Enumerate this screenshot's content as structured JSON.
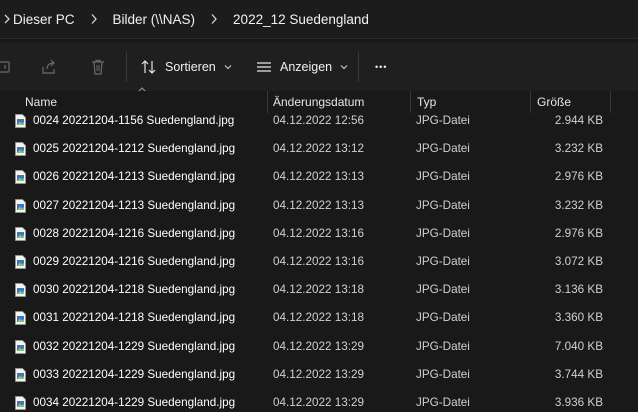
{
  "breadcrumb": {
    "items": [
      "Dieser PC",
      "Bilder (\\\\NAS)",
      "2022_12 Suedengland"
    ]
  },
  "toolbar": {
    "sort_label": "Sortieren",
    "view_label": "Anzeigen",
    "more_label": "•••"
  },
  "columns": {
    "name": "Name",
    "date": "Änderungsdatum",
    "type": "Typ",
    "size": "Größe"
  },
  "files": [
    {
      "name": "0024 20221204-1156 Suedengland.jpg",
      "date": "04.12.2022 12:56",
      "type": "JPG-Datei",
      "size": "2.944 KB"
    },
    {
      "name": "0025 20221204-1212 Suedengland.jpg",
      "date": "04.12.2022 13:12",
      "type": "JPG-Datei",
      "size": "3.232 KB"
    },
    {
      "name": "0026 20221204-1213 Suedengland.jpg",
      "date": "04.12.2022 13:13",
      "type": "JPG-Datei",
      "size": "2.976 KB"
    },
    {
      "name": "0027 20221204-1213 Suedengland.jpg",
      "date": "04.12.2022 13:13",
      "type": "JPG-Datei",
      "size": "3.232 KB"
    },
    {
      "name": "0028 20221204-1216 Suedengland.jpg",
      "date": "04.12.2022 13:16",
      "type": "JPG-Datei",
      "size": "2.976 KB"
    },
    {
      "name": "0029 20221204-1216 Suedengland.jpg",
      "date": "04.12.2022 13:16",
      "type": "JPG-Datei",
      "size": "3.072 KB"
    },
    {
      "name": "0030 20221204-1218 Suedengland.jpg",
      "date": "04.12.2022 13:18",
      "type": "JPG-Datei",
      "size": "3.136 KB"
    },
    {
      "name": "0031 20221204-1218 Suedengland.jpg",
      "date": "04.12.2022 13:18",
      "type": "JPG-Datei",
      "size": "3.360 KB"
    },
    {
      "name": "0032 20221204-1229 Suedengland.jpg",
      "date": "04.12.2022 13:29",
      "type": "JPG-Datei",
      "size": "7.040 KB"
    },
    {
      "name": "0033 20221204-1229 Suedengland.jpg",
      "date": "04.12.2022 13:29",
      "type": "JPG-Datei",
      "size": "3.744 KB"
    },
    {
      "name": "0034 20221204-1229 Suedengland.jpg",
      "date": "04.12.2022 13:29",
      "type": "JPG-Datei",
      "size": "3.936 KB"
    }
  ]
}
